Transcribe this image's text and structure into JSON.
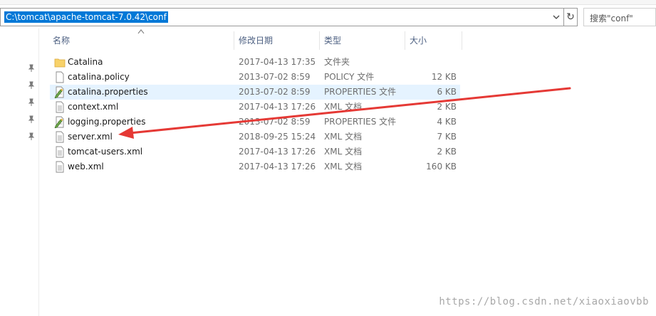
{
  "address_bar": {
    "path": "C:\\tomcat\\apache-tomcat-7.0.42\\conf"
  },
  "search": {
    "placeholder": "搜索\"conf\""
  },
  "columns": {
    "name": "名称",
    "date": "修改日期",
    "type": "类型",
    "size": "大小"
  },
  "files": [
    {
      "name": "Catalina",
      "date": "2017-04-13 17:35",
      "type": "文件夹",
      "size": "",
      "icon": "folder-icon"
    },
    {
      "name": "catalina.policy",
      "date": "2013-07-02 8:59",
      "type": "POLICY 文件",
      "size": "12 KB",
      "icon": "file-icon"
    },
    {
      "name": "catalina.properties",
      "date": "2013-07-02 8:59",
      "type": "PROPERTIES 文件",
      "size": "6 KB",
      "icon": "properties-file-icon",
      "selected": true
    },
    {
      "name": "context.xml",
      "date": "2017-04-13 17:26",
      "type": "XML 文档",
      "size": "2 KB",
      "icon": "xml-file-icon"
    },
    {
      "name": "logging.properties",
      "date": "2013-07-02 8:59",
      "type": "PROPERTIES 文件",
      "size": "4 KB",
      "icon": "properties-file-icon"
    },
    {
      "name": "server.xml",
      "date": "2018-09-25 15:24",
      "type": "XML 文档",
      "size": "7 KB",
      "icon": "xml-file-icon"
    },
    {
      "name": "tomcat-users.xml",
      "date": "2017-04-13 17:26",
      "type": "XML 文档",
      "size": "2 KB",
      "icon": "xml-file-icon"
    },
    {
      "name": "web.xml",
      "date": "2017-04-13 17:26",
      "type": "XML 文档",
      "size": "160 KB",
      "icon": "xml-file-icon"
    }
  ],
  "watermark": "https://blog.csdn.net/xiaoxiaovbb",
  "colors": {
    "selection": "#0078d7",
    "row_highlight": "#e5f3ff",
    "annotation_arrow": "#e53935"
  }
}
